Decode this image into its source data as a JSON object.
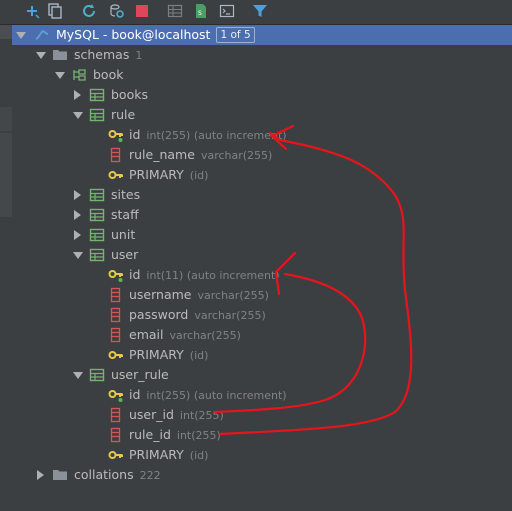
{
  "toolbar": {
    "buttons": [
      "add-icon",
      "copy-icon",
      "refresh-icon",
      "schema-sync-icon",
      "stop-icon",
      "table-view-icon",
      "ddl-icon",
      "console-icon",
      "filter-icon"
    ]
  },
  "tree": {
    "datasource": {
      "label": "MySQL - book@localhost",
      "badge": "1 of 5"
    },
    "schemas": {
      "label": "schemas",
      "count": "1"
    },
    "book": {
      "label": "book"
    },
    "books": {
      "label": "books"
    },
    "rule": {
      "label": "rule",
      "id": {
        "label": "id",
        "meta": "int(255) (auto increment)"
      },
      "rule_name": {
        "label": "rule_name",
        "meta": "varchar(255)"
      },
      "primary": {
        "label": "PRIMARY",
        "meta": "(id)"
      }
    },
    "sites": {
      "label": "sites"
    },
    "staff": {
      "label": "staff"
    },
    "unit": {
      "label": "unit"
    },
    "user": {
      "label": "user",
      "id": {
        "label": "id",
        "meta": "int(11) (auto increment)"
      },
      "username": {
        "label": "username",
        "meta": "varchar(255)"
      },
      "password": {
        "label": "password",
        "meta": "varchar(255)"
      },
      "email": {
        "label": "email",
        "meta": "varchar(255)"
      },
      "primary": {
        "label": "PRIMARY",
        "meta": "(id)"
      }
    },
    "user_rule": {
      "label": "user_rule",
      "id": {
        "label": "id",
        "meta": "int(255) (auto increment)"
      },
      "user_id": {
        "label": "user_id",
        "meta": "int(255)"
      },
      "rule_id": {
        "label": "rule_id",
        "meta": "int(255)"
      },
      "primary": {
        "label": "PRIMARY",
        "meta": "(id)"
      }
    },
    "collations": {
      "label": "collations",
      "count": "222"
    }
  },
  "colors": {
    "background": "#3c3f41",
    "selection": "#4b6eaf",
    "text": "#bbbbbb",
    "muted": "#7f8287",
    "annotation": "#e8141b",
    "table_icon": "#74b56e",
    "key_icon": "#e6c84a"
  }
}
